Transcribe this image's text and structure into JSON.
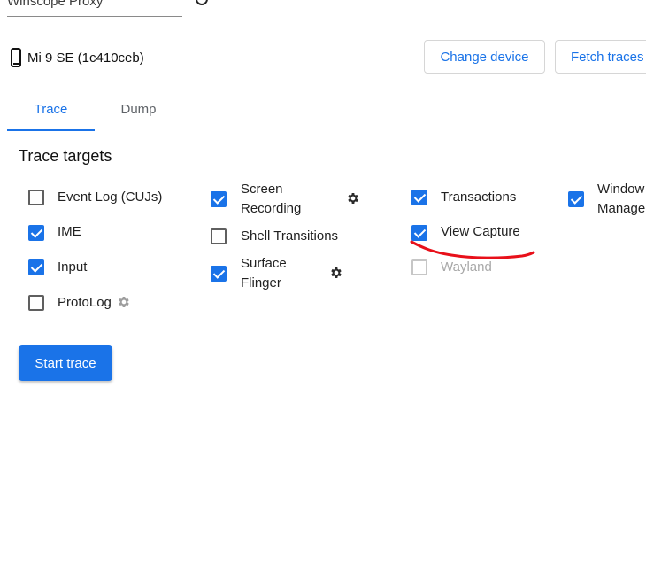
{
  "proxy": {
    "value": "Winscope Proxy"
  },
  "device": {
    "name": "Mi 9 SE (1c410ceb)"
  },
  "buttons": {
    "change_device": "Change device",
    "fetch_traces": "Fetch traces",
    "start_trace": "Start trace"
  },
  "tabs": [
    {
      "label": "Trace",
      "active": true
    },
    {
      "label": "Dump",
      "active": false
    }
  ],
  "section_title": "Trace targets",
  "targets": {
    "event_log": {
      "label": "Event Log (CUJs)",
      "checked": false
    },
    "ime": {
      "label": "IME",
      "checked": true
    },
    "input": {
      "label": "Input",
      "checked": true
    },
    "protolog": {
      "label": "ProtoLog",
      "checked": false
    },
    "screen_recording": {
      "line1": "Screen",
      "line2": "Recording",
      "checked": true
    },
    "shell_transitions": {
      "label": "Shell Transitions",
      "checked": false
    },
    "surface_flinger": {
      "line1": "Surface",
      "line2": "Flinger",
      "checked": true
    },
    "transactions": {
      "label": "Transactions",
      "checked": true
    },
    "view_capture": {
      "label": "View Capture",
      "checked": true
    },
    "wayland": {
      "label": "Wayland",
      "checked": false,
      "disabled": true
    },
    "window_manager": {
      "line1": "Window",
      "line2": "Manager",
      "checked": true
    }
  },
  "colors": {
    "accent": "#1a73e8",
    "annotation": "#e8101a"
  },
  "icons": {
    "help": "help-circle-icon",
    "phone": "smartphone-icon",
    "settings": "gear-icon"
  }
}
